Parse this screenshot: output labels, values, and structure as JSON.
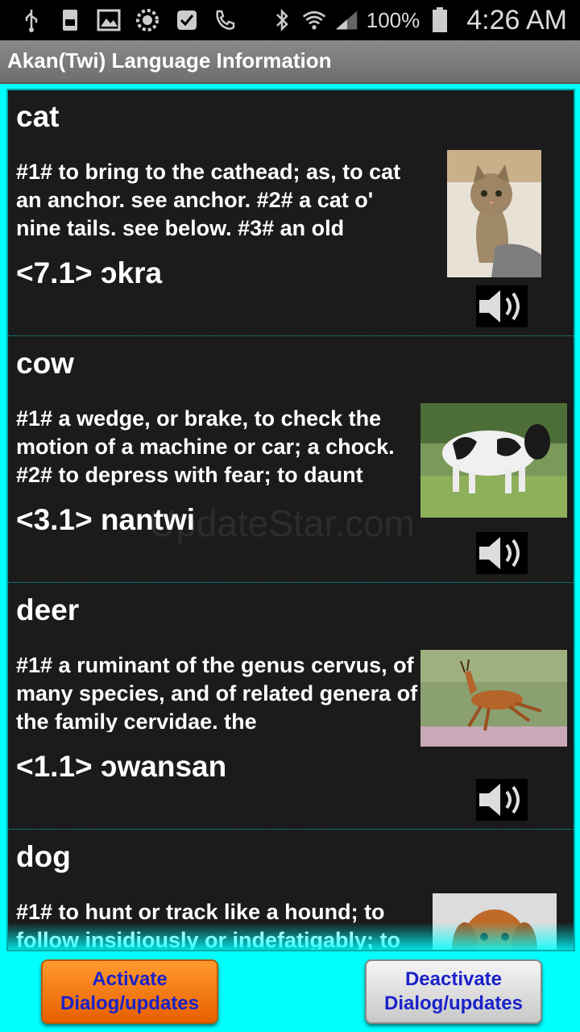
{
  "status_bar": {
    "icons": [
      "usb-icon",
      "storage-icon",
      "gallery-icon",
      "settings-icon",
      "check-icon",
      "phone-icon",
      "bluetooth-icon",
      "wifi-icon",
      "signal-icon"
    ],
    "battery_percent": "100%",
    "time": "4:26 AM"
  },
  "header": {
    "title": "Akan(Twi) Language Information"
  },
  "watermark": "UpdateStar.com",
  "entries": [
    {
      "word": "cat",
      "definition": "#1# to bring to the cathead; as, to cat an anchor. see anchor. #2# a cat o' nine tails. see below. #3# an old",
      "translation": "<7.1> ɔkra",
      "image": "cat"
    },
    {
      "word": "cow",
      "definition": "#1# a wedge, or brake, to check the motion of a machine or car; a chock. #2# to depress with fear; to daunt",
      "translation": "<3.1> nantwi",
      "image": "cow"
    },
    {
      "word": "deer",
      "definition": "#1# a ruminant of the genus cervus, of many species, and of related genera of the family cervidae. the",
      "translation": "<1.1> ɔwansan",
      "image": "deer"
    },
    {
      "word": "dog",
      "definition": "#1# to hunt or track like a hound; to follow insidiously or indefatigably; to",
      "translation": "",
      "image": "dog"
    }
  ],
  "buttons": {
    "activate": "Activate Dialog/updates",
    "deactivate": "Deactivate Dialog/updates"
  },
  "colors": {
    "background": "#00ffff",
    "list_bg": "#1b1b1b",
    "activate": "#f07a10",
    "button_text": "#1a22c8"
  }
}
